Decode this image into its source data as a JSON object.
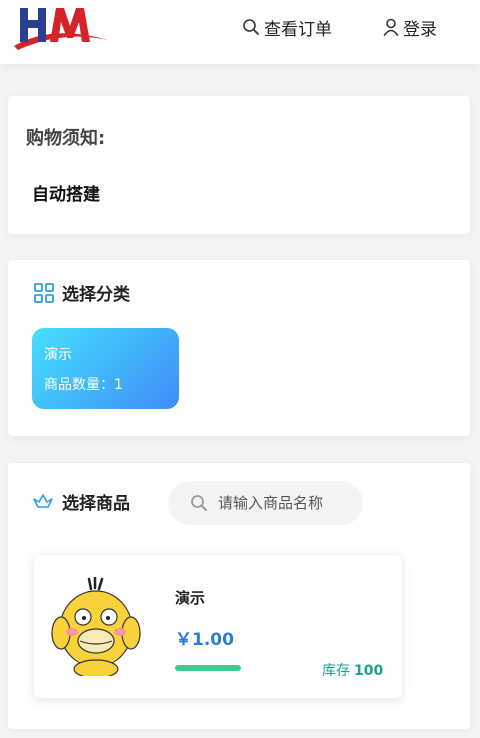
{
  "header": {
    "orders_label": "查看订单",
    "login_label": "登录",
    "icons": {
      "orders": "search-icon",
      "login": "user-icon"
    },
    "logo_colors": {
      "primary": "#2c3e91",
      "accent": "#d6232a"
    }
  },
  "notice": {
    "title": "购物须知:",
    "text": "自动搭建"
  },
  "category": {
    "title": "选择分类",
    "icon": "grid-icon",
    "items": [
      {
        "name": "演示",
        "count_label": "商品数量：1"
      }
    ]
  },
  "products_section": {
    "title": "选择商品",
    "icon": "crown-icon",
    "search_placeholder": "请输入商品名称"
  },
  "products": [
    {
      "name": "演示",
      "price": "￥1.00",
      "stock_label": "库存",
      "stock_value": "100",
      "stock_fill": 1.0,
      "image": "duck-illustration"
    }
  ],
  "colors": {
    "accent": "#2f7bd8",
    "stock": "#1aa08f",
    "progress": "#3ccc8f",
    "category_gradient_start": "#44e0ff",
    "category_gradient_end": "#3f8cf6"
  }
}
